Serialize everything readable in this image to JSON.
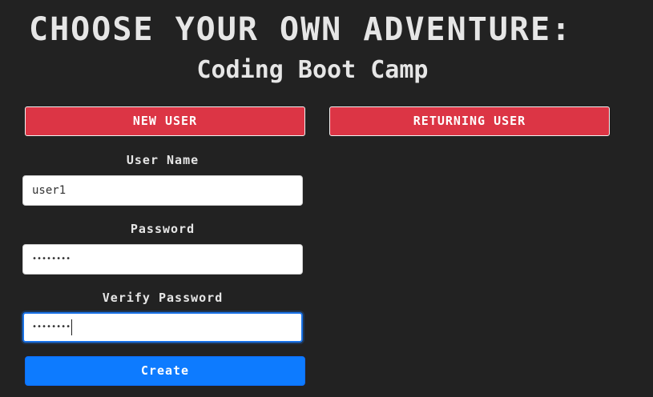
{
  "header": {
    "title": "CHOOSE YOUR OWN ADVENTURE:",
    "subtitle": "Coding Boot Camp"
  },
  "tabs": {
    "new_user": "NEW USER",
    "returning_user": "RETURNING USER"
  },
  "form": {
    "username": {
      "label": "User Name",
      "value": "user1"
    },
    "password": {
      "label": "Password",
      "masked_value": "••••••••"
    },
    "verify_password": {
      "label": "Verify Password",
      "masked_value": "••••••••",
      "focused": true
    },
    "submit_label": "Create"
  },
  "colors": {
    "background": "#222222",
    "tab_button": "#dc3545",
    "primary_button": "#0d7bff",
    "focus_ring": "#1a73e8",
    "text": "#e6e6e6"
  }
}
